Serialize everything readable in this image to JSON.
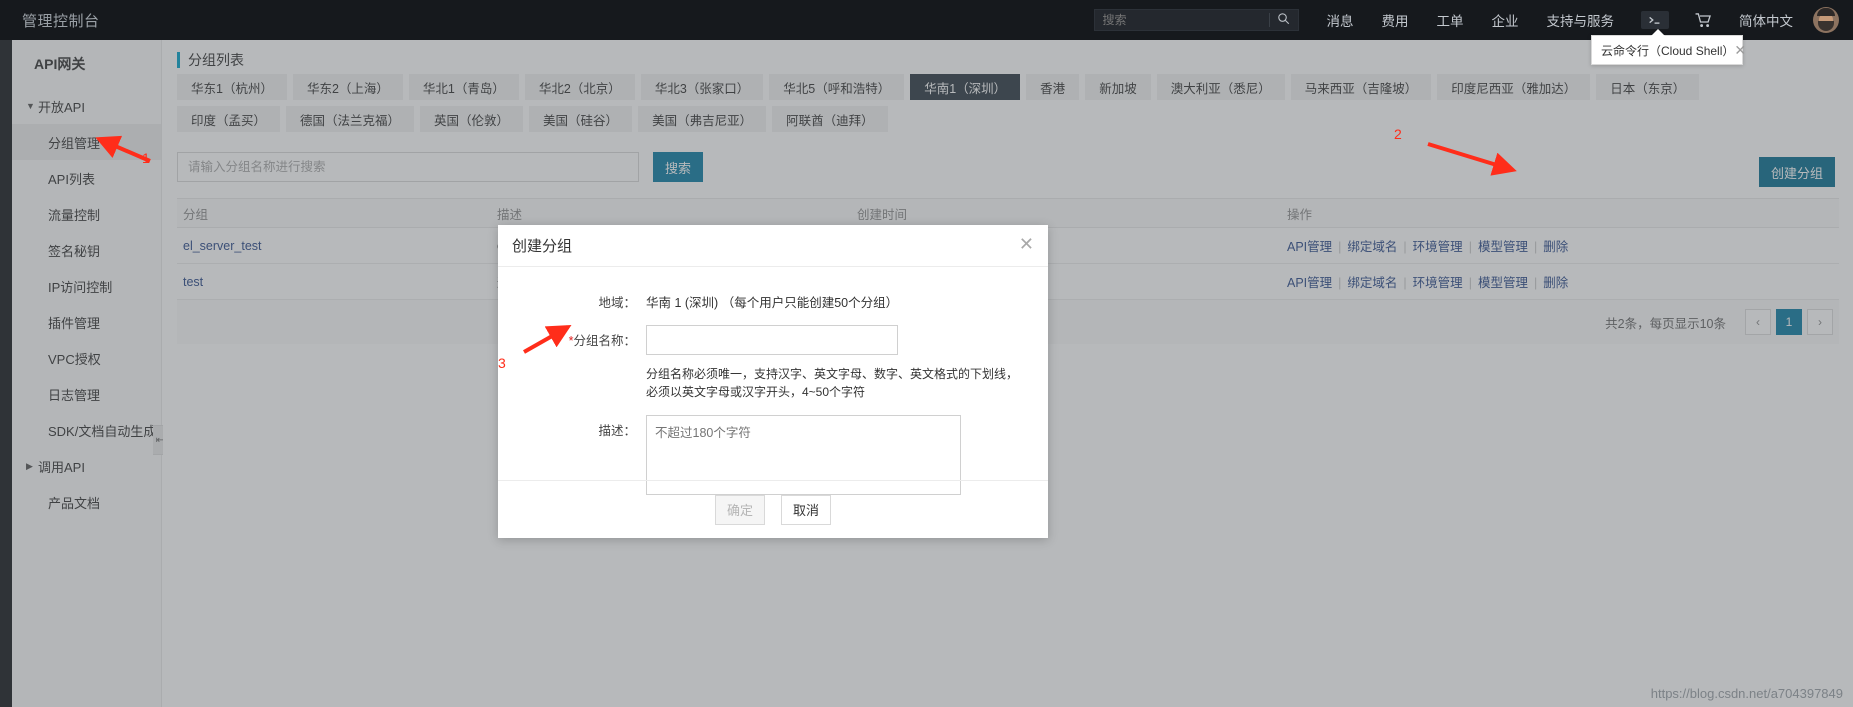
{
  "topbar": {
    "brand": "管理控制台",
    "search_placeholder": "搜索",
    "search_value": "",
    "search_icon": "search-icon",
    "links": [
      "消息",
      "费用",
      "工单",
      "企业",
      "支持与服务"
    ],
    "cloud_shell_icon": "terminal-icon",
    "cart_icon": "shopping-cart-icon",
    "language": "简体中文",
    "avatar": "user-avatar"
  },
  "shell_tooltip": {
    "text": "云命令行（Cloud Shell）",
    "close": "✕"
  },
  "sidebar": {
    "title": "API网关",
    "groups": [
      {
        "label": "开放API",
        "expanded": true,
        "caret": "▼"
      },
      {
        "label": "调用API",
        "expanded": false,
        "caret": "▶"
      }
    ],
    "items": [
      {
        "label": "分组管理",
        "active": true
      },
      {
        "label": "API列表",
        "active": false
      },
      {
        "label": "流量控制",
        "active": false
      },
      {
        "label": "签名秘钥",
        "active": false
      },
      {
        "label": "IP访问控制",
        "active": false
      },
      {
        "label": "插件管理",
        "active": false
      },
      {
        "label": "VPC授权",
        "active": false
      },
      {
        "label": "日志管理",
        "active": false
      },
      {
        "label": "SDK/文档自动生成",
        "active": false
      }
    ],
    "footer_item": "产品文档",
    "collapse_icon": "collapse-panel-icon"
  },
  "page": {
    "title": "分组列表"
  },
  "regions": {
    "row1": [
      {
        "label": "华东1（杭州）",
        "active": false
      },
      {
        "label": "华东2（上海）",
        "active": false
      },
      {
        "label": "华北1（青岛）",
        "active": false
      },
      {
        "label": "华北2（北京）",
        "active": false
      },
      {
        "label": "华北3（张家口）",
        "active": false
      },
      {
        "label": "华北5（呼和浩特）",
        "active": false
      },
      {
        "label": "华南1（深圳）",
        "active": true
      },
      {
        "label": "香港",
        "active": false
      },
      {
        "label": "新加坡",
        "active": false
      },
      {
        "label": "澳大利亚（悉尼）",
        "active": false
      },
      {
        "label": "马来西亚（吉隆坡）",
        "active": false
      },
      {
        "label": "印度尼西亚（雅加达）",
        "active": false
      },
      {
        "label": "日本（东京）",
        "active": false
      }
    ],
    "row2": [
      {
        "label": "印度（孟买）",
        "active": false
      },
      {
        "label": "德国（法兰克福）",
        "active": false
      },
      {
        "label": "英国（伦敦）",
        "active": false
      },
      {
        "label": "美国（硅谷）",
        "active": false
      },
      {
        "label": "美国（弗吉尼亚）",
        "active": false
      },
      {
        "label": "阿联酋（迪拜）",
        "active": false
      }
    ]
  },
  "toolbar": {
    "search_placeholder": "请输入分组名称进行搜索",
    "search_value": "",
    "search_button": "搜索",
    "create_button": "创建分组"
  },
  "table": {
    "columns": [
      "分组",
      "描述",
      "创建时间",
      "操作"
    ],
    "rows": [
      {
        "group": "el_server_test",
        "desc": "e",
        "time": "",
        "ops": [
          "API管理",
          "绑定域名",
          "环境管理",
          "模型管理",
          "删除"
        ]
      },
      {
        "group": "test",
        "desc": "这",
        "time": "",
        "ops": [
          "API管理",
          "绑定域名",
          "环境管理",
          "模型管理",
          "删除"
        ]
      }
    ],
    "footer_summary": "共2条，每页显示10条",
    "pager": {
      "prev": "‹",
      "pages": [
        "1"
      ],
      "current": "1",
      "next": "›"
    }
  },
  "modal": {
    "title": "创建分组",
    "close_icon": "close-icon",
    "region_label": "地域：",
    "region_value": "华南 1 (深圳) （每个用户只能创建50个分组）",
    "name_label": "分组名称：",
    "name_required": "*",
    "name_value": "",
    "name_hint": "分组名称必须唯一，支持汉字、英文字母、数字、英文格式的下划线，必须以英文字母或汉字开头，4~50个字符",
    "desc_label": "描述：",
    "desc_placeholder": "不超过180个字符",
    "desc_value": "",
    "ok_button": "确定",
    "cancel_button": "取消"
  },
  "annotations": [
    {
      "id": "1",
      "label": "1"
    },
    {
      "id": "2",
      "label": "2"
    },
    {
      "id": "3",
      "label": "3"
    }
  ],
  "watermark": "https://blog.csdn.net/a704397849",
  "colors": {
    "topbar_bg": "#16191d",
    "accent": "#0d7ca4",
    "region_active_bg": "#2e3a44",
    "link": "#2b4a8b",
    "annotation": "#ff2d1a"
  }
}
